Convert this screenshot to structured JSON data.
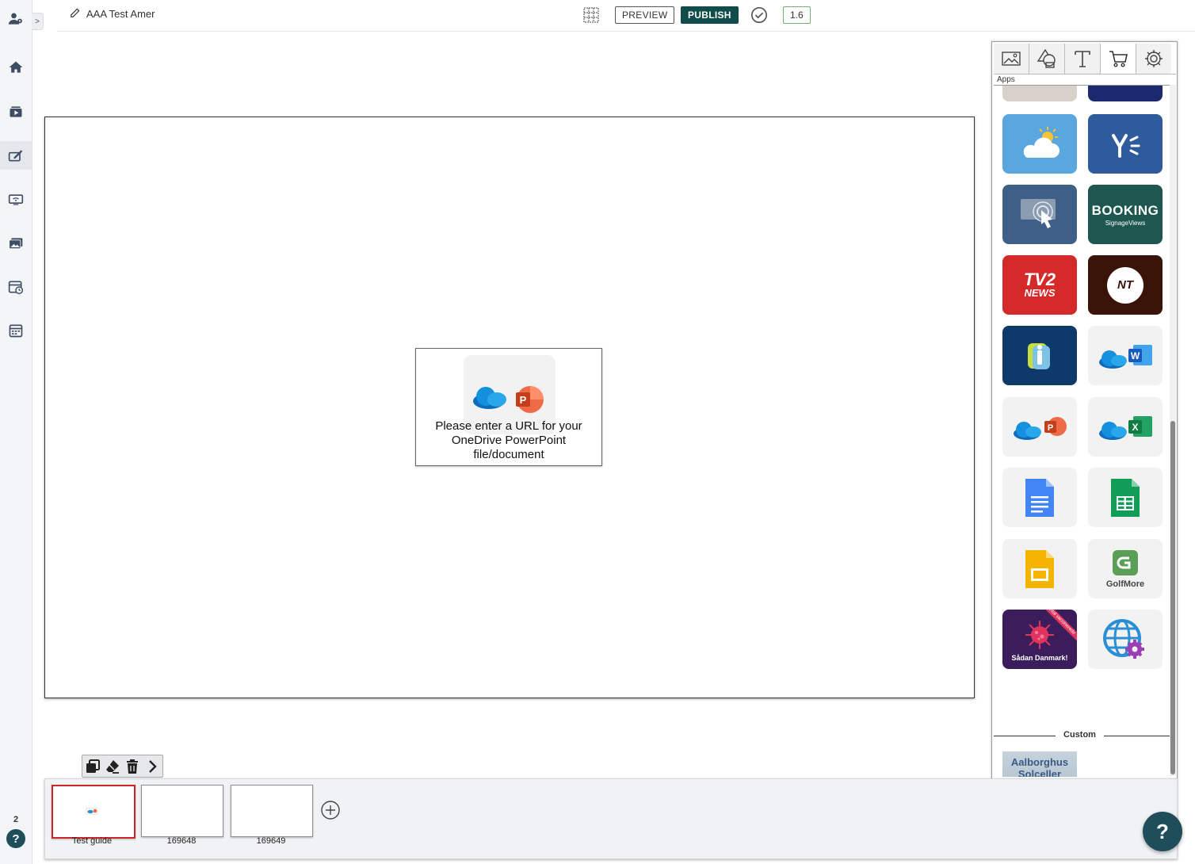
{
  "topbar": {
    "document_title": "AAA Test Amer",
    "preview_label": "PREVIEW",
    "publish_label": "PUBLISH",
    "version": "1.6"
  },
  "rail": {
    "toggle": ">",
    "items": [
      "users-settings-icon",
      "home-icon",
      "media-icon",
      "editor-icon",
      "display-icon",
      "gallery-icon",
      "schedule-icon",
      "calendar-icon"
    ],
    "notification_count": "2",
    "help": "?"
  },
  "canvas": {
    "widget_text": "Please enter a URL for your OneDrive PowerPoint file/document"
  },
  "panel": {
    "tabs": [
      "image-tab",
      "shapes-tab",
      "text-tab",
      "apps-tab",
      "settings-tab"
    ],
    "active_tab": "apps-tab",
    "section_label": "Apps",
    "apps": [
      {
        "name": "weather",
        "color": "#5aa7df"
      },
      {
        "name": "yammer",
        "color": "#2e5b9c"
      },
      {
        "name": "touch",
        "color": "#3e5f86"
      },
      {
        "name": "booking",
        "title": "BOOKING",
        "subtitle": "SignageViews",
        "color": "#1d5750"
      },
      {
        "name": "tv2-news",
        "line1": "TV2",
        "line2": "NEWS",
        "color": "#d42a2a"
      },
      {
        "name": "nt",
        "text": "NT",
        "color": "#3a1408"
      },
      {
        "name": "info",
        "color": "#0d3a6a"
      },
      {
        "name": "onedrive-word",
        "color": "#f2f2f2"
      },
      {
        "name": "onedrive-powerpoint",
        "color": "#f2f2f2"
      },
      {
        "name": "onedrive-excel",
        "color": "#f2f2f2"
      },
      {
        "name": "google-docs",
        "color": "#f2f2f2"
      },
      {
        "name": "google-sheets",
        "color": "#f2f2f2"
      },
      {
        "name": "google-slides",
        "color": "#f2f2f2"
      },
      {
        "name": "golfmore",
        "text": "GolfMore",
        "color": "#f2f2f2"
      },
      {
        "name": "covid",
        "text": "Sådan Danmark!",
        "ribbon": "Antal vaccinerede",
        "color": "#3c1d5c"
      },
      {
        "name": "web-settings",
        "color": "#f2f2f2"
      }
    ],
    "custom_label": "Custom",
    "custom_apps": [
      {
        "name": "aalborghus-solceller",
        "line1": "Aalborghus",
        "line2": "Solceller"
      }
    ]
  },
  "timeline": {
    "toolbar": [
      "duplicate-icon",
      "eraser-icon",
      "trash-icon",
      "chevron-right-icon"
    ],
    "slides": [
      {
        "label": "Test guide",
        "selected": true
      },
      {
        "label": "169648",
        "selected": false
      },
      {
        "label": "169649",
        "selected": false
      }
    ]
  },
  "help_fab": "?"
}
